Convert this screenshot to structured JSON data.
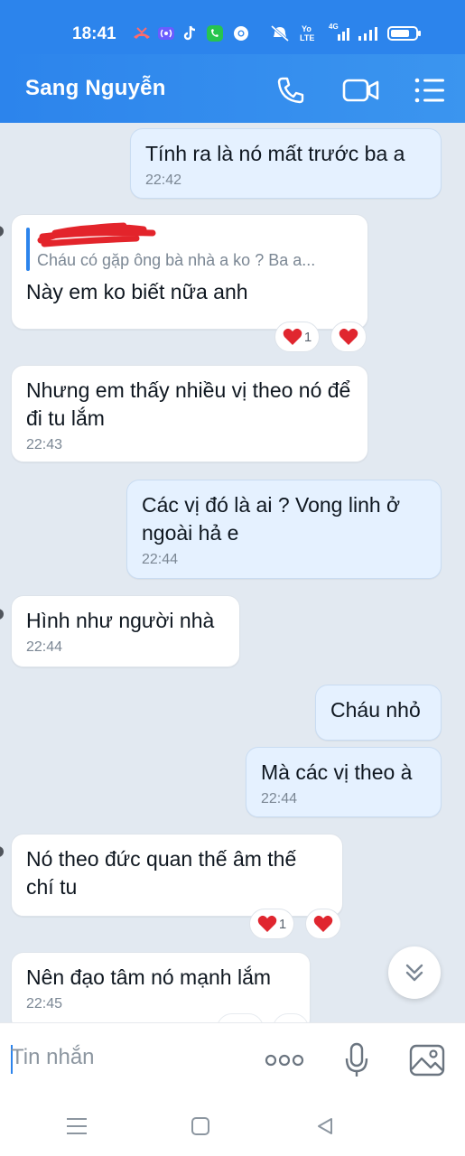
{
  "status_bar": {
    "time": "18:41",
    "network_label_top": "Yo",
    "network_label_bottom": "LTE",
    "network_gen": "4G",
    "icons": [
      "missed-call-icon",
      "hotspot-icon",
      "tiktok-icon",
      "whatsapp-icon",
      "chrome-icon",
      "mute-icon",
      "signal-icon",
      "signal-icon",
      "battery-icon"
    ]
  },
  "header": {
    "contact_name": "Sang Nguyễn",
    "icons": [
      "phone-icon",
      "video-call-icon",
      "menu-list-icon"
    ]
  },
  "messages": [
    {
      "direction": "out",
      "text": "Tính ra là nó mất trước ba a",
      "time": "22:42"
    },
    {
      "direction": "in",
      "quote_text": "Cháu có gặp ông bà nhà a ko ? Ba a...",
      "text": "Này em ko biết nữa anh",
      "reaction_count": "1"
    },
    {
      "direction": "in",
      "text": "Nhưng em thấy nhiều vị theo nó để đi tu lắm",
      "time": "22:43"
    },
    {
      "direction": "out",
      "text": "Các vị đó là ai ? Vong linh ở ngoài hả e",
      "time": "22:44"
    },
    {
      "direction": "in",
      "text": "Hình như người nhà",
      "time": "22:44"
    },
    {
      "direction": "out",
      "text": "Cháu nhỏ"
    },
    {
      "direction": "out",
      "text": "Mà các vị theo à",
      "time": "22:44"
    },
    {
      "direction": "in",
      "text": "Nó theo đức quan thế âm thế chí tu",
      "reaction_count": "1"
    },
    {
      "direction": "in",
      "text": "Nên đạo tâm nó mạnh lắm",
      "time": "22:45"
    }
  ],
  "input_bar": {
    "placeholder": "Tin nhắn",
    "icons": [
      "more-options-icon",
      "microphone-icon",
      "image-icon"
    ]
  },
  "nav_bar": {
    "icons": [
      "recent-apps-icon",
      "home-icon",
      "back-icon"
    ]
  },
  "colors": {
    "header_blue": "#2c84ec",
    "chat_background": "#e2e9f1",
    "outgoing_bubble": "#e5f1ff",
    "incoming_bubble": "#ffffff",
    "heart": "#e0262f",
    "redaction": "#e3242b"
  }
}
